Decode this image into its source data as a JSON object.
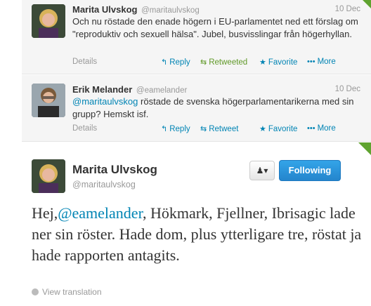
{
  "tweets": [
    {
      "fullname": "Marita Ulvskog",
      "username": "@maritaulvskog",
      "date": "10 Dec",
      "text": "Och nu röstade den enade högern i EU-parlamentet ned ett förslag om \"reproduktiv och sexuell hälsa\". Jubel, busvisslingar från högerhyllan.",
      "details": "Details",
      "reply": "Reply",
      "retweet": "Retweeted",
      "favorite": "Favorite",
      "more": "More"
    },
    {
      "fullname": "Erik Melander",
      "username": "@eamelander",
      "date": "10 Dec",
      "mention": "@maritaulvskog",
      "text": " röstade de svenska högerparlamentarikerna med sin grupp? Hemskt isf.",
      "details": "Details",
      "reply": "Reply",
      "retweet": "Retweet",
      "favorite": "Favorite",
      "more": "More"
    }
  ],
  "main": {
    "fullname": "Marita Ulvskog",
    "username": "@maritaulvskog",
    "following_label": "Following",
    "text_before": "Hej,",
    "mention": "@eamelander",
    "text_after": ", Hökmark, Fjellner, Ibrisagic lade ner sin röster. Hade dom, plus ytterligare tre, röstat ja hade rapporten antagits.",
    "view_translation": "View translation"
  },
  "icons": {
    "reply": "reply-arrow-icon",
    "retweet": "retweet-icon",
    "favorite": "star-icon",
    "more": "ellipsis-icon",
    "user": "user-dropdown-icon",
    "globe": "globe-icon"
  },
  "colors": {
    "link": "#0084b4",
    "retweeted": "#609928",
    "follow_button": "#2b8fd8",
    "corner": "#5fa32f"
  }
}
